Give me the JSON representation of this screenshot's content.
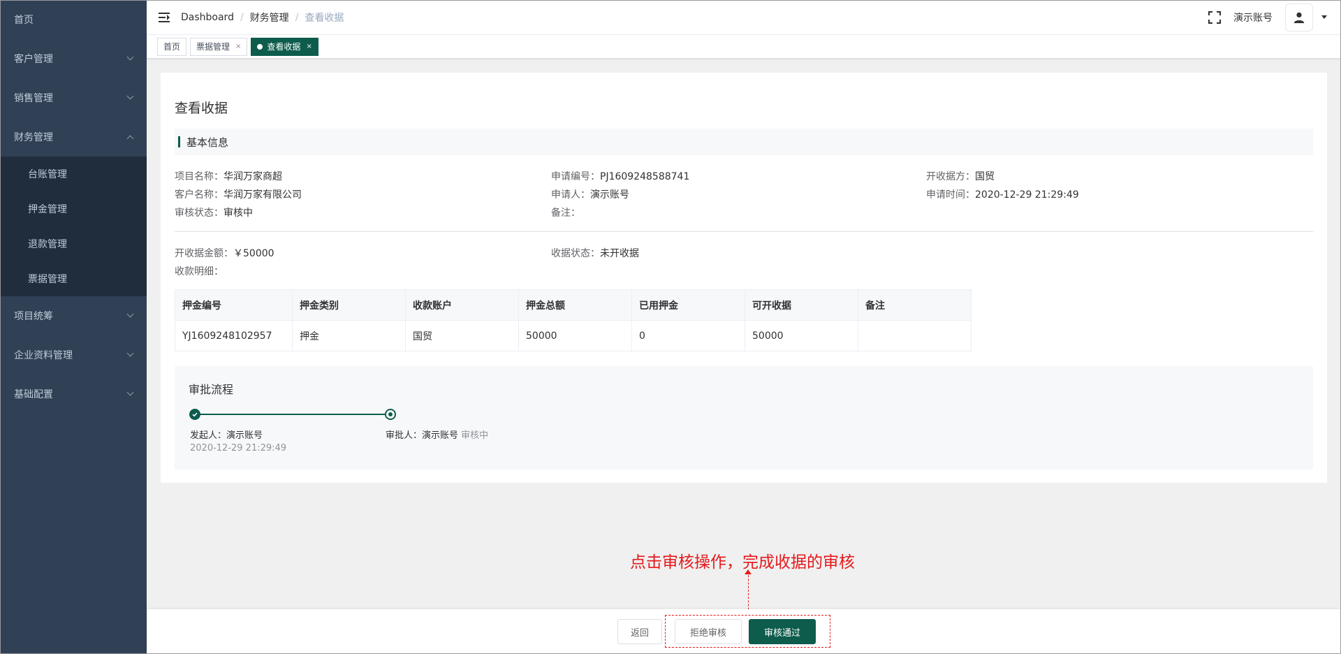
{
  "sidebar": {
    "items": [
      {
        "label": "首页"
      },
      {
        "label": "客户管理"
      },
      {
        "label": "销售管理"
      },
      {
        "label": "财务管理"
      },
      {
        "label": "项目统筹"
      },
      {
        "label": "企业资料管理"
      },
      {
        "label": "基础配置"
      }
    ],
    "finance_sub": [
      "台账管理",
      "押金管理",
      "退款管理",
      "票据管理"
    ]
  },
  "header": {
    "breadcrumb": [
      "Dashboard",
      "财务管理",
      "查看收据"
    ],
    "username": "演示账号"
  },
  "tags": [
    {
      "label": "首页"
    },
    {
      "label": "票据管理",
      "close": "×"
    },
    {
      "label": "查看收据",
      "close": "×"
    }
  ],
  "page": {
    "title": "查看收据",
    "section": "基本信息",
    "info": {
      "project_name": {
        "label": "项目名称：",
        "value": "华润万家商超"
      },
      "apply_no": {
        "label": "申请编号：",
        "value": "PJ1609248588741"
      },
      "issuer": {
        "label": "开收据方：",
        "value": "国贸"
      },
      "customer": {
        "label": "客户名称：",
        "value": "华润万家有限公司"
      },
      "applicant": {
        "label": "申请人：",
        "value": "演示账号"
      },
      "apply_time": {
        "label": "申请时间：",
        "value": "2020-12-29 21:29:49"
      },
      "audit_status": {
        "label": "审核状态：",
        "value": "审核中"
      },
      "remark": {
        "label": "备注：",
        "value": ""
      },
      "amount": {
        "label": "开收据金额：",
        "value": "￥50000"
      },
      "receipt_status": {
        "label": "收据状态：",
        "value": "未开收据"
      },
      "detail_label": {
        "label": "收款明细：",
        "value": ""
      }
    },
    "table": {
      "headers": [
        "押金编号",
        "押金类别",
        "收款账户",
        "押金总额",
        "已用押金",
        "可开收据",
        "备注"
      ],
      "rows": [
        [
          "YJ1609248102957",
          "押金",
          "国贸",
          "50000",
          "0",
          "50000",
          ""
        ]
      ]
    },
    "flow": {
      "title": "审批流程",
      "initiator": "发起人：演示账号",
      "initiator_time": "2020-12-29 21:29:49",
      "approver": "审批人：演示账号",
      "approver_status": "审核中"
    }
  },
  "annotation": "点击审核操作，完成收据的审核",
  "footer": {
    "back": "返回",
    "reject": "拒绝审核",
    "approve": "审核通过"
  },
  "colors": {
    "accent": "#0d5c4c",
    "sidebar": "#304156",
    "annotation": "#e5191c"
  }
}
